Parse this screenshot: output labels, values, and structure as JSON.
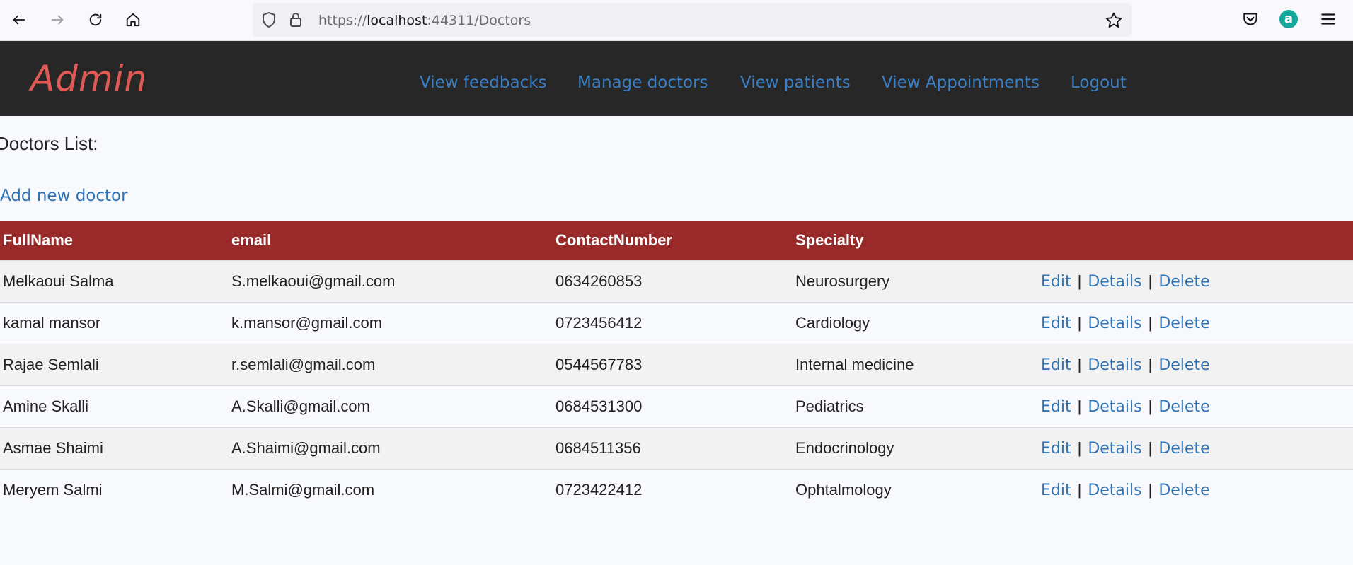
{
  "browser": {
    "url_prefix": "https://",
    "url_host": "localhost",
    "url_rest": ":44311/Doctors",
    "account_initial": "a",
    "icons": [
      "back-arrow-icon",
      "forward-arrow-icon",
      "reload-icon",
      "home-icon",
      "shield-icon",
      "lock-icon",
      "star-icon",
      "pocket-icon",
      "account-icon",
      "menu-icon"
    ]
  },
  "navbar": {
    "brand": "Admin",
    "links": [
      {
        "label": "View feedbacks"
      },
      {
        "label": "Manage doctors"
      },
      {
        "label": "View patients"
      },
      {
        "label": "View Appointments"
      },
      {
        "label": "Logout"
      }
    ]
  },
  "page": {
    "heading": "Doctors List:",
    "add_link": "Add new doctor"
  },
  "table": {
    "headers": [
      "FullName",
      "email",
      "ContactNumber",
      "Specialty",
      ""
    ],
    "rows": [
      {
        "name": "Melkaoui Salma",
        "email": "S.melkaoui@gmail.com",
        "contact": "0634260853",
        "specialty": "Neurosurgery"
      },
      {
        "name": "kamal mansor",
        "email": "k.mansor@gmail.com",
        "contact": "0723456412",
        "specialty": "Cardiology"
      },
      {
        "name": "Rajae Semlali",
        "email": "r.semlali@gmail.com",
        "contact": "0544567783",
        "specialty": "Internal medicine"
      },
      {
        "name": "Amine Skalli",
        "email": "A.Skalli@gmail.com",
        "contact": "0684531300",
        "specialty": "Pediatrics"
      },
      {
        "name": "Asmae Shaimi",
        "email": "A.Shaimi@gmail.com",
        "contact": "0684511356",
        "specialty": "Endocrinology"
      },
      {
        "name": "Meryem Salmi",
        "email": "M.Salmi@gmail.com",
        "contact": "0723422412",
        "specialty": "Ophtalmology"
      }
    ],
    "actions": {
      "edit": "Edit",
      "details": "Details",
      "delete": "Delete",
      "separator": "|"
    }
  },
  "colors": {
    "navbar_bg": "#272727",
    "brand": "#e05a55",
    "link": "#3b7fc4",
    "table_header_bg": "#9a2a2a"
  }
}
